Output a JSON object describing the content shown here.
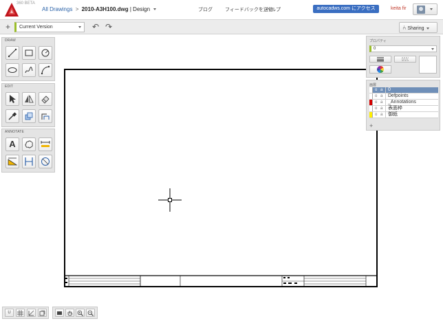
{
  "header": {
    "product_badge": "360 BETA",
    "breadcrumb": {
      "root": "All Drawings",
      "separator": ">",
      "file": "2010-A3H100.dwg",
      "mode": "| Design"
    },
    "links": {
      "blog": "ブログ",
      "feedback": "フィードバックを送信",
      "help": "ヘルプ"
    },
    "access_button": "autocadws.com にアクセス",
    "user_name": "keita fir"
  },
  "toolbar": {
    "plus": "+",
    "version_select": "Current Version",
    "undo": "↶",
    "redo": "↷",
    "sharing": "Sharing"
  },
  "palettes": {
    "draw": {
      "title": "DRAW",
      "tools": [
        "line-tool-icon",
        "rectangle-tool-icon",
        "circle-tool-icon",
        "ellipse-tool-icon",
        "freehand-tool-icon",
        "arc-tool-icon"
      ]
    },
    "edit": {
      "title": "EDIT",
      "tools": [
        "select-tool-icon",
        "mirror-tool-icon",
        "erase-tool-icon",
        "color-picker-tool-icon",
        "copy-tool-icon",
        "offset-tool-icon"
      ]
    },
    "annotate": {
      "title": "ANNOTATE",
      "tools": [
        "text-tool-icon",
        "cloud-markup-icon",
        "linear-dimension-icon",
        "area-measure-icon",
        "aligned-dimension-icon",
        "radius-dimension-icon"
      ]
    },
    "annotate_text_glyph": "A"
  },
  "properties": {
    "title": "プロパティ",
    "layer_value": "0"
  },
  "layers": {
    "title": "画層",
    "add": "+",
    "visible_glyph": "o",
    "lock_glyph": "a",
    "items": [
      {
        "name": "0",
        "color": "#ffffff",
        "selected": true
      },
      {
        "name": "Defpoints",
        "color": "#ffffff",
        "selected": false
      },
      {
        "name": "_Annotations",
        "color": "#d40000",
        "selected": false
      },
      {
        "name": "表面枠",
        "color": "#ffffff",
        "selected": false
      },
      {
        "name": "御紙",
        "color": "#ffee00",
        "selected": false
      }
    ]
  },
  "statusbar": {
    "left": [
      "snap-toggle-icon",
      "grid-toggle-icon",
      "ortho-toggle-icon",
      "polar-toggle-icon"
    ],
    "right": [
      "screen-icon",
      "pan-icon",
      "zoom-in-icon",
      "zoom-out-icon"
    ],
    "snap_label": "U"
  },
  "colors": {
    "accent_blue": "#3a6ec1",
    "version_indicator": "#9bbe2b",
    "layer_selected": "#6f8fb8",
    "user_name": "#c0392b"
  }
}
